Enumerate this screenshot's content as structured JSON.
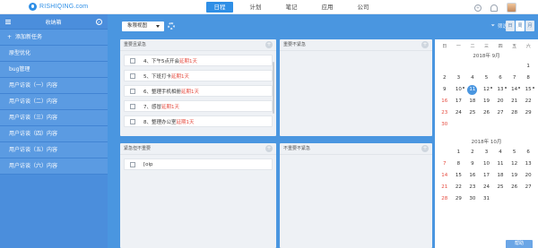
{
  "app": {
    "logo_text": "RISHIQING.com"
  },
  "nav": {
    "items": [
      "日程",
      "计划",
      "笔记",
      "应用",
      "公司"
    ],
    "active": 0
  },
  "top_icons": {
    "add_symbol": "+"
  },
  "sidebar": {
    "title": "收纳箱",
    "add_label": "添加新任务",
    "items": [
      "原型优化",
      "bug管理",
      "用户访谈（一）内容",
      "用户访谈（二）内容",
      "用户访谈（三）内容",
      "用户访谈（四）内容",
      "用户访谈（五）内容",
      "用户访谈（六）内容"
    ]
  },
  "toolbar": {
    "dropdown_label": "象限视图",
    "filter_label": "筛选",
    "view_buttons": [
      "日",
      "周",
      "月"
    ]
  },
  "quadrants": {
    "q1": {
      "title": "重要且紧急",
      "tasks": [
        {
          "text": "4、下午5点开会",
          "delay": "延期1天"
        },
        {
          "text": "5、下班打卡",
          "delay": "延期1天"
        },
        {
          "text": "6、整理手机相册",
          "delay": "延期1天"
        },
        {
          "text": "7、感冒",
          "delay": "延期1天"
        },
        {
          "text": "8、整理办公室",
          "delay": "延期1天"
        }
      ]
    },
    "q2": {
      "title": "重要不紧急",
      "tasks": []
    },
    "q3": {
      "title": "紧急但不重要",
      "tasks": [
        {
          "text": "[oip",
          "delay": ""
        }
      ]
    },
    "q4": {
      "title": "不重要不紧急",
      "tasks": []
    }
  },
  "calendar": {
    "weekdays": [
      "日",
      "一",
      "二",
      "三",
      "四",
      "五",
      "六"
    ],
    "months": [
      {
        "title": "2018年 9月",
        "leading_blanks": 6,
        "days": 30,
        "today": 11,
        "red": [
          16,
          23,
          30
        ],
        "dots": [
          10,
          12,
          13,
          14,
          15
        ]
      },
      {
        "title": "2018年 10月",
        "leading_blanks": 1,
        "days": 31,
        "today": null,
        "red": [
          7,
          14,
          21,
          28
        ],
        "dots": []
      }
    ]
  },
  "help": {
    "label": "帮助"
  }
}
